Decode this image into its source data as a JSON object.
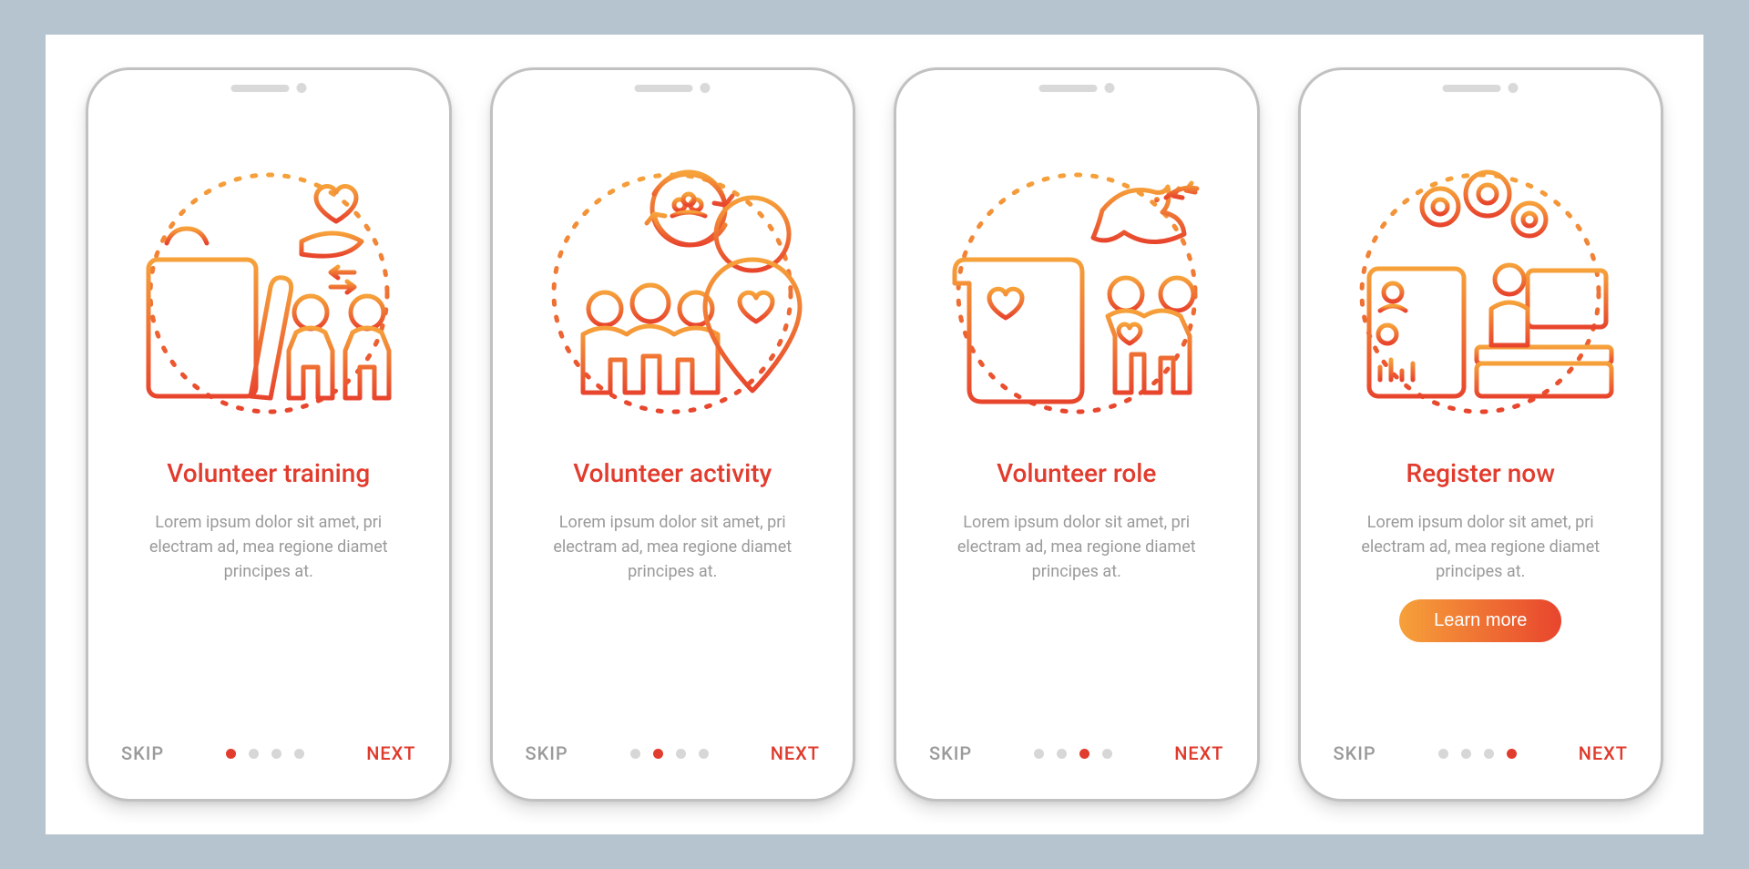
{
  "colors": {
    "accent_start": "#f6a13a",
    "accent_end": "#e8452d",
    "text_muted": "#9a9a9a",
    "dot_inactive": "#d7d7d7"
  },
  "nav": {
    "skip": "SKIP",
    "next": "NEXT"
  },
  "pagination": {
    "count": 4
  },
  "screens": [
    {
      "icon": "volunteer-training-icon",
      "title": "Volunteer training",
      "body": "Lorem ipsum dolor sit amet, pri electram ad, mea regione diamet principes at.",
      "active_index": 0,
      "has_cta": false
    },
    {
      "icon": "volunteer-activity-icon",
      "title": "Volunteer activity",
      "body": "Lorem ipsum dolor sit amet, pri electram ad, mea regione diamet principes at.",
      "active_index": 1,
      "has_cta": false
    },
    {
      "icon": "volunteer-role-icon",
      "title": "Volunteer role",
      "body": "Lorem ipsum dolor sit amet, pri electram ad, mea regione diamet principes at.",
      "active_index": 2,
      "has_cta": false
    },
    {
      "icon": "register-now-icon",
      "title": "Register now",
      "body": "Lorem ipsum dolor sit amet, pri electram ad, mea regione diamet principes at.",
      "active_index": 3,
      "has_cta": true,
      "cta_label": "Learn more"
    }
  ]
}
